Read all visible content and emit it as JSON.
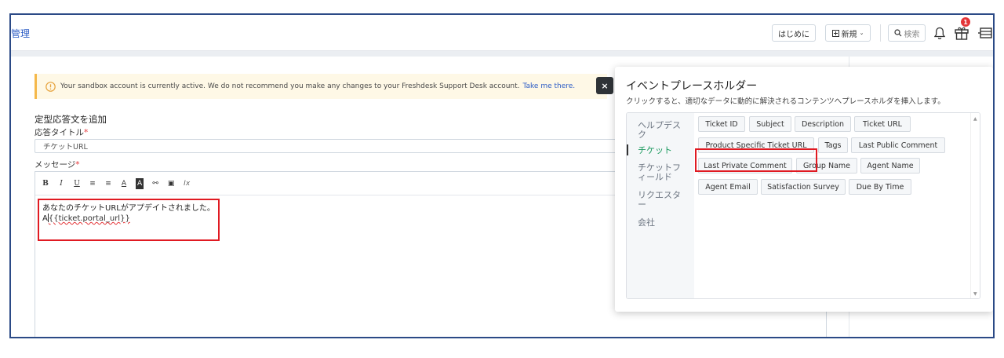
{
  "header": {
    "title": "管理",
    "buttons": {
      "getting_started": "はじめに",
      "new_label": "新規",
      "search_label": "検索"
    },
    "notification_badge": "1"
  },
  "alert": {
    "message": "Your sandbox account is currently active. We do not recommend you make any changes to your Freshdesk Support Desk account.",
    "link": "Take me there.",
    "close": "×"
  },
  "form": {
    "heading": "定型応答文を追加",
    "title_label": "応答タイトル",
    "title_value": "チケットURL",
    "message_label": "メッセージ",
    "required_mark": "*",
    "editor": {
      "line1": "あなたのチケットURLがアプデイトされました。",
      "line2_prefix": "A",
      "line2_code": "{{ticket.portal_url}}"
    }
  },
  "toolbar": [
    "B",
    "I",
    "U",
    "≡",
    "≡",
    "A",
    "A",
    "⚯",
    "▣",
    "Ix"
  ],
  "popover": {
    "title": "イベントプレースホルダー",
    "subtitle": "クリックすると、適切なデータに動的に解決されるコンテンツへプレースホルダを挿入します。",
    "categories": [
      "ヘルプデスク",
      "チケット",
      "チケットフィールド",
      "リクエスター",
      "会社"
    ],
    "placeholders": [
      "Ticket ID",
      "Subject",
      "Description",
      "Ticket URL",
      "Product Specific Ticket URL",
      "Tags",
      "Last Public Comment",
      "Last Private Comment",
      "Group Name",
      "Agent Name",
      "Agent Email",
      "Satisfaction Survey",
      "Due By Time"
    ]
  },
  "colors": {
    "link": "#2c5cc5",
    "active_category": "#1b9a5e",
    "highlight": "#e01a22",
    "alert_bg": "#fef8e6"
  }
}
